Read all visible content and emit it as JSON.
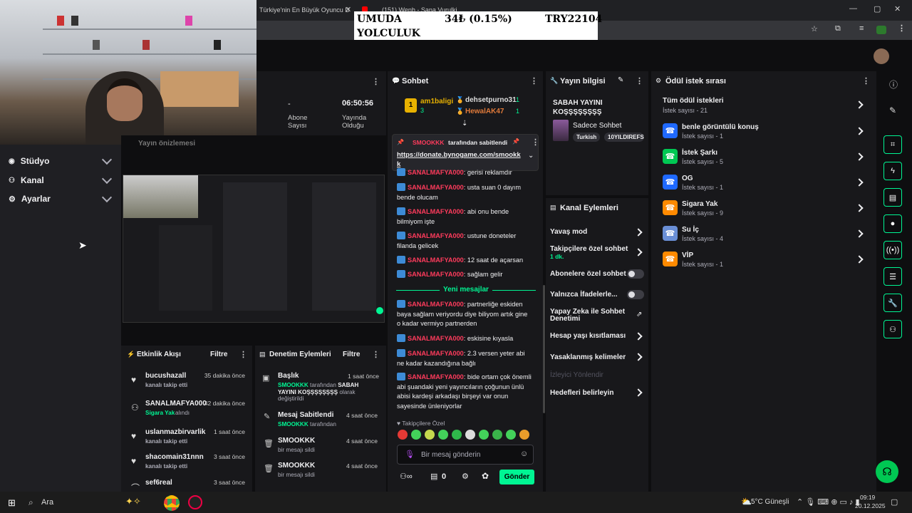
{
  "ticker": {
    "line1": "UMUDA",
    "line2": "YOLCULUK",
    "price": "34₺ (0.15%)",
    "code": "TRY22104"
  },
  "browser": {
    "tab1": "Türkiye'nin En Büyük Oyuncu D",
    "tab2": "(151) Wenb - Sana Vurulki"
  },
  "leftnav": {
    "items": [
      {
        "label": "Stüdyo"
      },
      {
        "label": "Kanal"
      },
      {
        "label": "Ayarlar"
      }
    ]
  },
  "stats": {
    "dash": "-",
    "subs_label": "Abone Sayısı",
    "time": "06:50:56",
    "uptime_label": "Yayında Olduğu",
    "preview_label": "Yayın önizlemesi"
  },
  "chat": {
    "title": "Sohbet",
    "top_gifters": [
      {
        "rank": "1",
        "name": "am1baligi",
        "count": "3"
      },
      {
        "name": "dehsetpurno31",
        "count": "1"
      },
      {
        "name": "HewalAK47",
        "count": "1"
      }
    ],
    "pinned": {
      "by": "SMOOKKK",
      "text": "tarafından sabitlendi",
      "link": "https://donate.bynogame.com/smookkk"
    },
    "messages": [
      {
        "user": "SANALMAFYA000",
        "text": "gerisi reklamdır"
      },
      {
        "user": "SANALMAFYA000",
        "text": "usta suan 0 dayım bende olucam"
      },
      {
        "user": "SANALMAFYA000",
        "text": "abi onu bende bilmiyom işte"
      },
      {
        "user": "SANALMAFYA000",
        "text": "ustune doneteler filanda gelicek"
      },
      {
        "user": "SANALMAFYA000",
        "text": "12 saat de açarsan"
      },
      {
        "user": "SANALMAFYA000",
        "text": "sağlam gelir"
      }
    ],
    "new_label": "Yeni mesajlar",
    "new_messages": [
      {
        "user": "SANALMAFYA000",
        "text": "partnerliğe eskiden baya sağlam veriyordu diye biliyom artık gine o kadar vermiyo partnerden"
      },
      {
        "user": "SANALMAFYA000",
        "text": "eskisine kıyasla"
      },
      {
        "user": "SANALMAFYA000",
        "text": "2.3 versen yeter abi ne kadar kazandığına bağlı"
      },
      {
        "user": "SANALMAFYA000",
        "text": "bide ortam çok önemli abi şuandaki yeni yayıncıların çoğunun ünlü abisi kardeşi arkadaşı birşeyi var onun sayesinde ünleniyorlar"
      }
    ],
    "followers_only": "Takipçilere Özel",
    "input_placeholder": "Bir mesaj gönderin",
    "count": "0",
    "send": "Gönder"
  },
  "stream_info": {
    "title": "Yayın bilgisi",
    "stream_title": "SABAH YAYINI KOŞŞŞŞŞŞŞŞ",
    "category": "Sadece Sohbet",
    "tags": [
      "Turkish",
      "10YILDIREFS"
    ]
  },
  "channel_actions": {
    "title": "Kanal Eylemleri",
    "items": [
      {
        "label": "Yavaş mod"
      },
      {
        "label": "Takipçilere özel sohbet",
        "sub": "1 dk."
      },
      {
        "label": "Abonelere özel sohbet"
      },
      {
        "label": "Yalnızca İfadelerle..."
      },
      {
        "label": "Yapay Zeka ile Sohbet Denetimi"
      },
      {
        "label": "Hesap yaşı kısıtlaması"
      },
      {
        "label": "Yasaklanmış kelimeler"
      },
      {
        "label": "İzleyici Yönlendir"
      },
      {
        "label": "Hedefleri belirleyin"
      }
    ]
  },
  "rewards": {
    "title": "Ödül istek sırası",
    "all": {
      "label": "Tüm ödül istekleri",
      "sub": "İstek sayısı - 21"
    },
    "items": [
      {
        "label": "benle görüntülü konuş",
        "sub": "İstek sayısı - 1",
        "color": "#1f69ff"
      },
      {
        "label": "İstek Şarkı",
        "sub": "İstek sayısı - 5",
        "color": "#00c853"
      },
      {
        "label": "OG",
        "sub": "İstek sayısı - 1",
        "color": "#1f69ff"
      },
      {
        "label": "Sigara Yak",
        "sub": "İstek sayısı - 9",
        "color": "#ff8a00"
      },
      {
        "label": "Su İç",
        "sub": "İstek sayısı - 4",
        "color": "#6a8fd6"
      },
      {
        "label": "VİP",
        "sub": "İstek sayısı - 1",
        "color": "#ff8a00"
      }
    ]
  },
  "activity": {
    "title": "Etkinlik Akışı",
    "filter": "Filtre",
    "items": [
      {
        "name": "bucushazall",
        "time": "35 dakika önce",
        "sub": "kanalı takip etti"
      },
      {
        "name": "SANALMAFYA000",
        "time": "42 dakika önce",
        "sub": "Sigara Yak",
        "sub2": "alındı"
      },
      {
        "name": "uslanmazbirvarlik",
        "time": "1 saat önce",
        "sub": "kanalı takip etti"
      },
      {
        "name": "shacomain31nnn",
        "time": "3 saat önce",
        "sub": "kanalı takip etti"
      },
      {
        "name": "sef6real",
        "time": "3 saat önce",
        "sub": ""
      }
    ]
  },
  "modlog": {
    "title": "Denetim Eylemleri",
    "filter": "Filtre",
    "items": [
      {
        "name": "Başlık",
        "time": "1 saat önce",
        "by": "SMOOKKK",
        "mid": "tarafından",
        "value": "SABAH YAYINI KOŞŞŞŞŞŞŞŞ",
        "tail": "olarak değiştirildi"
      },
      {
        "name": "Mesaj Sabitlendi",
        "time": "4 saat önce",
        "by": "SMOOKKK",
        "mid": "tarafından"
      },
      {
        "name": "SMOOKKK",
        "time": "4 saat önce",
        "sub": "bir mesajı sildi"
      },
      {
        "name": "SMOOKKK",
        "time": "4 saat önce",
        "sub": "bir mesajı sildi"
      }
    ]
  },
  "taskbar": {
    "search": "Ara",
    "weather": "5°C Güneşli",
    "time": "09:19",
    "date": "20.12.2025"
  }
}
